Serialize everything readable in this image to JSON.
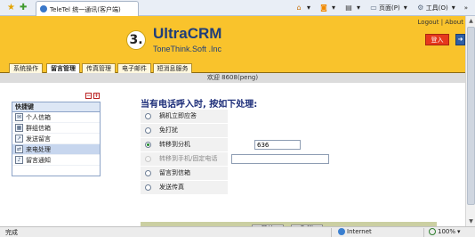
{
  "browser": {
    "tab_title": "TeleTel 统一通讯(客户端)",
    "tools": {
      "page_label": "页面(P)",
      "tools_label": "工具(O)",
      "overflow": "»"
    }
  },
  "header": {
    "links": {
      "logout": "Logout",
      "separator": " | ",
      "about": "About"
    },
    "logo_number": "3.",
    "logo_name": "UltraCRM",
    "logo_sub": "ToneThink.Soft .Inc",
    "login_label": "登入"
  },
  "nav": {
    "items": [
      {
        "label": "系统操作"
      },
      {
        "label": "留言管理"
      },
      {
        "label": "传真管理"
      },
      {
        "label": "电子邮件"
      },
      {
        "label": "短消息服务"
      }
    ],
    "active_index": 1
  },
  "welcome": "欢迎 8608(peng)",
  "sidebar": {
    "collapse": "−",
    "expand": "+",
    "title": "快捷键",
    "items": [
      {
        "label": "个人信箱"
      },
      {
        "label": "群组信箱"
      },
      {
        "label": "发送留言"
      },
      {
        "label": "来电处理"
      },
      {
        "label": "留言通知"
      }
    ],
    "active_index": 3
  },
  "form": {
    "title": "当有电话呼入时, 按如下处理:",
    "options": [
      {
        "label": "摘机立即应答",
        "checked": false,
        "disabled": false
      },
      {
        "label": "免打扰",
        "checked": false,
        "disabled": false
      },
      {
        "label": "转移到分机",
        "checked": true,
        "disabled": false,
        "value": "636"
      },
      {
        "label": "转移到手机/固定电话",
        "checked": false,
        "disabled": true,
        "value": ""
      },
      {
        "label": "留言到信箱",
        "checked": false,
        "disabled": false
      },
      {
        "label": "发送传真",
        "checked": false,
        "disabled": false
      }
    ],
    "ok_label": "确认",
    "cancel_label": "取消"
  },
  "status": {
    "text": "完成",
    "zone": "Internet",
    "zoom": "100%"
  }
}
